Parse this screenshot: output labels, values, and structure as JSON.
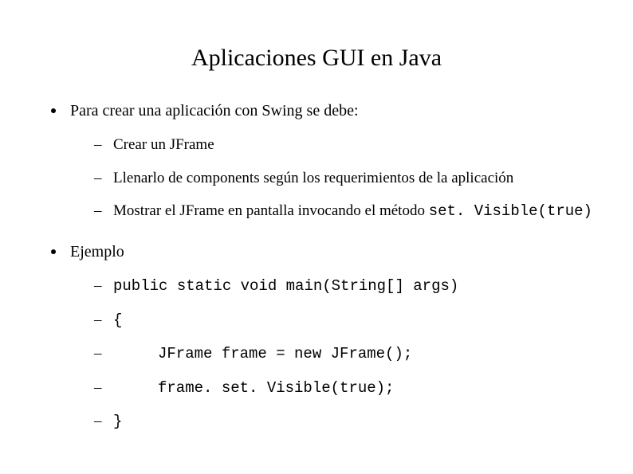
{
  "title": "Aplicaciones GUI en Java",
  "items": [
    {
      "text": "Para crear una aplicación con Swing se debe:",
      "sub": [
        {
          "text": "Crear un JFrame",
          "mono": false
        },
        {
          "text": "Llenarlo de components según los requerimientos de la aplicación",
          "mono": false
        },
        {
          "pre": "Mostrar el JFrame en pantalla invocando el método ",
          "code": "set. Visible(true)"
        }
      ]
    },
    {
      "text": "Ejemplo",
      "sub": [
        {
          "text": "public static void main(String[] args)",
          "mono": true
        },
        {
          "text": "{",
          "mono": true
        },
        {
          "text": "JFrame frame = new JFrame();",
          "mono": true,
          "indent": true
        },
        {
          "text": "frame. set. Visible(true);",
          "mono": true,
          "indent": true
        },
        {
          "text": "}",
          "mono": true
        }
      ]
    }
  ]
}
